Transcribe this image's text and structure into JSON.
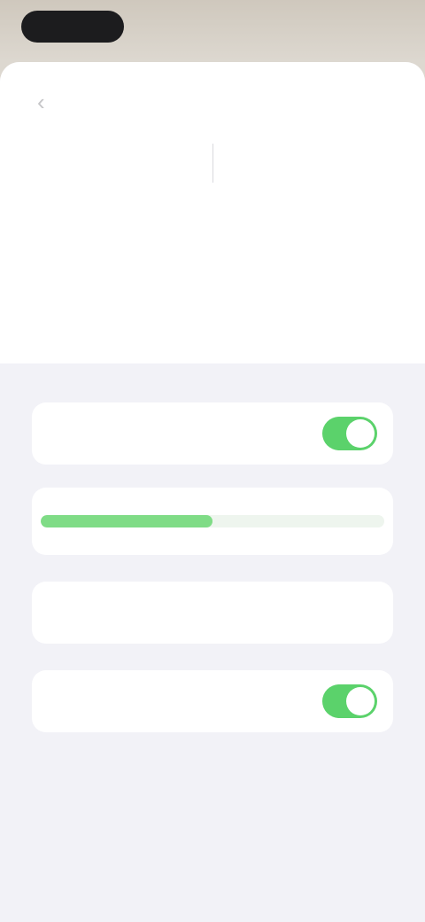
{
  "status": {
    "time": "",
    "indicators": ""
  },
  "nav": {
    "title": "",
    "back_icon": "chevron-left-icon"
  },
  "segments": [
    {
      "label": ""
    },
    {
      "label": ""
    }
  ],
  "description": "",
  "settings": {
    "toggle_1": {
      "label": "",
      "on": true
    },
    "toggle_1_footnote": "",
    "progress_header": "",
    "progress_percent": 50,
    "progress_footnote": "",
    "section_2_title": "",
    "row_value": {
      "label": "",
      "value": ""
    },
    "section_3_header": "",
    "toggle_2": {
      "label": "",
      "on": true
    }
  },
  "colors": {
    "accent": "#5bd26b",
    "background": "#f2f2f7"
  }
}
